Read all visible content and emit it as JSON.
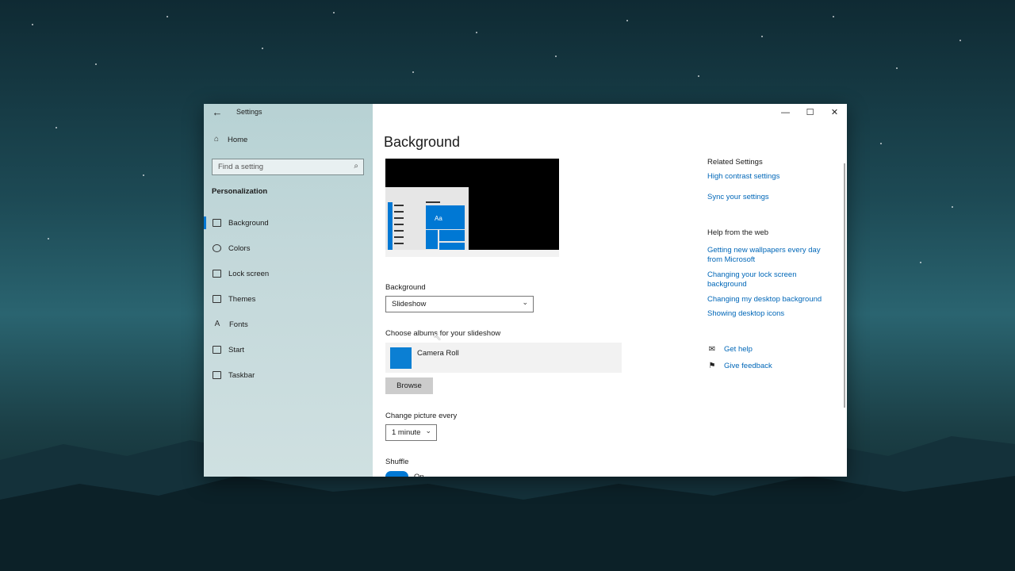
{
  "window": {
    "app_title": "Settings"
  },
  "sidebar": {
    "home_label": "Home",
    "search_placeholder": "Find a setting",
    "section_title": "Personalization",
    "items": [
      {
        "label": "Background",
        "icon": "picture-icon",
        "active": true
      },
      {
        "label": "Colors",
        "icon": "palette-icon",
        "active": false
      },
      {
        "label": "Lock screen",
        "icon": "lock-screen-icon",
        "active": false
      },
      {
        "label": "Themes",
        "icon": "brush-icon",
        "active": false
      },
      {
        "label": "Fonts",
        "icon": "font-icon",
        "active": false
      },
      {
        "label": "Start",
        "icon": "start-icon",
        "active": false
      },
      {
        "label": "Taskbar",
        "icon": "taskbar-icon",
        "active": false
      }
    ]
  },
  "main": {
    "title": "Background",
    "preview": {
      "tile_label": "Aa"
    },
    "background_label": "Background",
    "background_value": "Slideshow",
    "album_label": "Choose albums for your slideshow",
    "album_name": "Camera Roll",
    "browse_label": "Browse",
    "interval_label": "Change picture every",
    "interval_value": "1 minute",
    "shuffle_label": "Shuffle",
    "shuffle_state": "On"
  },
  "related": {
    "heading": "Related Settings",
    "links": [
      "High contrast settings",
      "Sync your settings"
    ],
    "help_heading": "Help from the web",
    "help_links": [
      "Getting new wallpapers every day from Microsoft",
      "Changing your lock screen background",
      "Changing my desktop background",
      "Showing desktop icons"
    ],
    "get_help": "Get help",
    "give_feedback": "Give feedback"
  },
  "colors": {
    "accent": "#0078d4",
    "link": "#0067b8"
  }
}
